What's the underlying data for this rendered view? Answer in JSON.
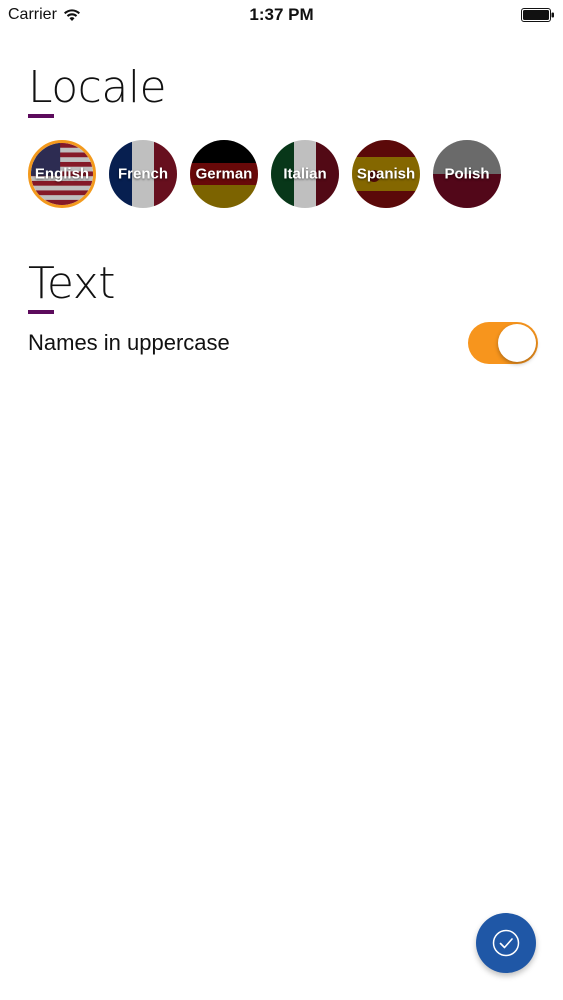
{
  "status_bar": {
    "carrier": "Carrier",
    "time": "1:37 PM"
  },
  "sections": {
    "locale_title": "Locale",
    "text_title": "Text"
  },
  "locales": [
    {
      "label": "English",
      "selected": true
    },
    {
      "label": "French",
      "selected": false
    },
    {
      "label": "German",
      "selected": false
    },
    {
      "label": "Italian",
      "selected": false
    },
    {
      "label": "Spanish",
      "selected": false
    },
    {
      "label": "Polish",
      "selected": false
    }
  ],
  "options": {
    "uppercase_label": "Names in uppercase",
    "uppercase_on": true
  },
  "colors": {
    "accent": "#5c0b5c",
    "toggle_on": "#f7951d",
    "selected_ring": "#f39a1d",
    "fab": "#1f57a6"
  },
  "icons": {
    "wifi": "wifi-icon",
    "battery": "battery-icon",
    "fab": "checkmark-icon"
  }
}
